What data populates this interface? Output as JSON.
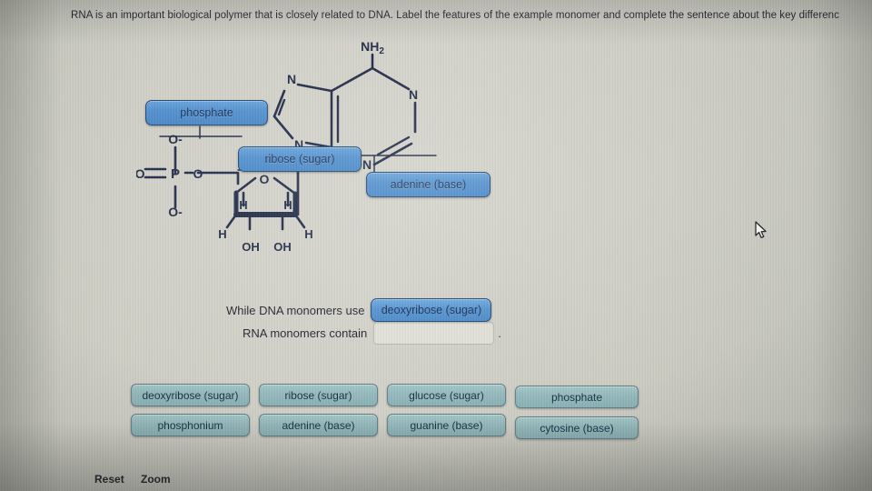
{
  "prompt": {
    "text": "RNA is an important biological polymer that is closely related to DNA.  Label the features of the example monomer and complete the sentence about the key differenc"
  },
  "structure": {
    "name": "adenosine-monophosphate-monomer",
    "atoms": {
      "amine": "NH₂",
      "purine_n1": "N",
      "purine_n3": "N",
      "purine_n7": "N",
      "purine_n9": "N",
      "phosphate_p": "P",
      "phosphate_o_double": "O",
      "phosphate_o_top": "O-",
      "phosphate_o_bottom": "O-",
      "phosphate_o_ester": "O",
      "ring_oxygen": "O",
      "h_left_upper": "H",
      "h_right_upper": "H",
      "h_left_lower": "H",
      "h_right_lower": "H",
      "oh_left": "OH",
      "oh_right": "OH"
    }
  },
  "placed_labels": [
    {
      "id": "phosphate",
      "label": "phosphate"
    },
    {
      "id": "ribose",
      "label": "ribose (sugar)"
    },
    {
      "id": "adenine",
      "label": "adenine (base)"
    }
  ],
  "sentence": {
    "line1_text": "While DNA monomers use",
    "line1_answer": "deoxyribose (sugar)",
    "line2_text": "RNA monomers contain",
    "line2_answer": "",
    "line2_placeholder": "",
    "terminator": "."
  },
  "answer_bank": {
    "items": [
      {
        "label": "deoxyribose (sugar)"
      },
      {
        "label": "ribose (sugar)"
      },
      {
        "label": "glucose (sugar)"
      },
      {
        "label": "phosphate"
      },
      {
        "label": "phosphonium"
      },
      {
        "label": "adenine (base)"
      },
      {
        "label": "guanine (base)"
      },
      {
        "label": "cytosine (base)"
      }
    ]
  },
  "toolbar": {
    "reset_label": "Reset",
    "zoom_label": "Zoom"
  },
  "cursor": {
    "icon": "arrow-pointer-cursor"
  },
  "colors": {
    "chip_blue": "#4a8bcc",
    "chip_border": "#1b3f6b",
    "bank_teal": "#93b8bc",
    "bank_border": "#5d7d86",
    "ink": "#16213f",
    "page_background": "#cdcdc4"
  }
}
